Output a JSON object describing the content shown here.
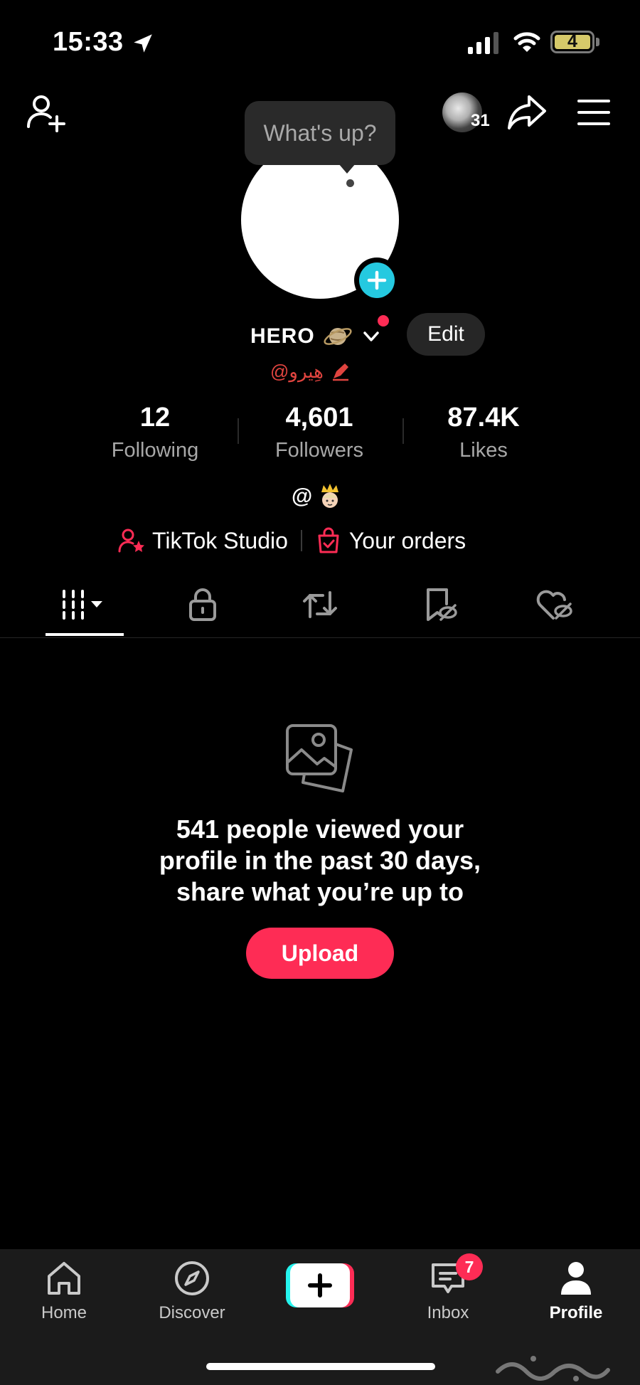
{
  "status_bar": {
    "time": "15:33",
    "battery": "4"
  },
  "top_bar": {
    "friends_count": "31"
  },
  "tooltip": {
    "text": "What's up?"
  },
  "profile": {
    "name": "HERO",
    "edit_label": "Edit",
    "handle": "@هِيرو",
    "bio": "@"
  },
  "stats": [
    {
      "value": "12",
      "label": "Following"
    },
    {
      "value": "4,601",
      "label": "Followers"
    },
    {
      "value": "87.4K",
      "label": "Likes"
    }
  ],
  "links": {
    "studio": "TikTok Studio",
    "orders": "Your orders"
  },
  "empty_state": {
    "message_line1": "541 people viewed your",
    "message_line2": "profile in the past 30 days,",
    "message_line3": "share what you’re up to",
    "upload_label": "Upload"
  },
  "bottom_nav": {
    "home": "Home",
    "discover": "Discover",
    "inbox": "Inbox",
    "inbox_badge": "7",
    "profile": "Profile"
  },
  "colors": {
    "accent": "#fe2c55",
    "cyan": "#25c9e0",
    "background": "#000000"
  }
}
